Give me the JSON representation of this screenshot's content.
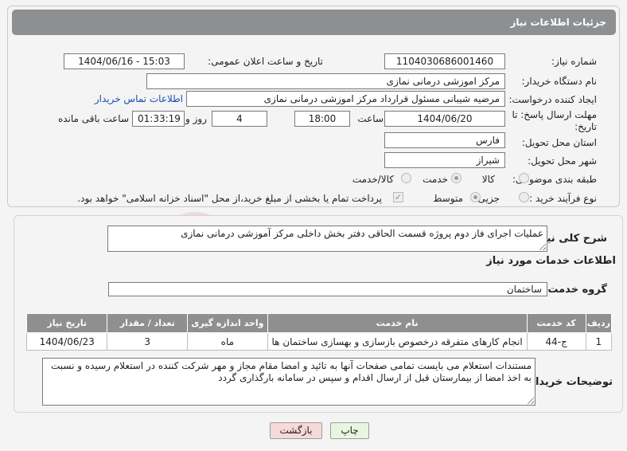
{
  "header": {
    "title": "جزئیات اطلاعات نیاز"
  },
  "fields": {
    "need_number": {
      "label": "شماره نیاز:",
      "value": "1104030686001460"
    },
    "announce": {
      "label": "تاریخ و ساعت اعلان عمومی:",
      "value": "1404/06/16 - 15:03"
    },
    "buyer_org": {
      "label": "نام دستگاه خریدار:",
      "value": "مرکز اموزشی درمانی نمازی"
    },
    "requester": {
      "label": "ایجاد کننده درخواست:",
      "value": "مرضیه شیبانی مسئول قرارداد مرکز اموزشی درمانی نمازی",
      "contact_link": "اطلاعات تماس خریدار"
    },
    "deadline": {
      "label_line1": "مهلت ارسال پاسخ: تا",
      "label_line2": "تاریخ:",
      "date": "1404/06/20",
      "time_label": "ساعت",
      "time": "18:00",
      "days": "4",
      "days_label": "روز و",
      "remaining": "01:33:19",
      "remaining_label": "ساعت باقی مانده"
    },
    "province": {
      "label": "استان محل تحویل:",
      "value": "فارس"
    },
    "city": {
      "label": "شهر محل تحویل:",
      "value": "شیراز"
    },
    "category": {
      "label": "طبقه بندی موضوعی:",
      "options": [
        "کالا",
        "خدمت",
        "کالا/خدمت"
      ],
      "selected": "خدمت"
    },
    "process": {
      "label": "نوع فرآیند خرید :",
      "options": [
        "جزیی",
        "متوسط"
      ],
      "selected": "متوسط",
      "payment_note": "پرداخت تمام یا بخشی از مبلغ خرید،از محل \"اسناد خزانه اسلامی\" خواهد بود."
    }
  },
  "summary": {
    "label": "شرح کلی نیاز:",
    "value": "عملیات اجرای فاز دوم پروژه قسمت الحاقی دفتر بخش داخلی مرکز آموزشی درمانی نمازی"
  },
  "services_title": "اطلاعات خدمات مورد نیاز",
  "service_group": {
    "label": "گروه خدمت:",
    "value": "ساختمان"
  },
  "table": {
    "headers": [
      "ردیف",
      "کد خدمت",
      "نام خدمت",
      "واحد اندازه گیری",
      "تعداد / مقدار",
      "تاریخ نیاز"
    ],
    "rows": [
      [
        "1",
        "ج-44",
        "انجام کارهای متفرقه درخصوص بازسازی و بهسازی ساختمان ها",
        "ماه",
        "3",
        "1404/06/23"
      ]
    ]
  },
  "buyer_notes": {
    "label": "توضیحات خریدار:",
    "value": "مستندات استعلام می بایست تمامی صفحات آنها به تائید و امضا مقام مجاز و مهر شرکت کننده در استعلام رسیده و نسبت به اخذ امضا از بیمارستان قبل از ارسال اقدام و سپس در سامانه بارگذاری گردد"
  },
  "buttons": {
    "print": "چاپ",
    "back": "بازگشت"
  },
  "watermark": {
    "text": "AriaTender.net"
  },
  "colors": {
    "header_bg": "#8d8f91",
    "link": "#1a4fb5",
    "back_btn_bg": "#f8d9d9",
    "print_btn_bg": "#e7f6e0"
  }
}
